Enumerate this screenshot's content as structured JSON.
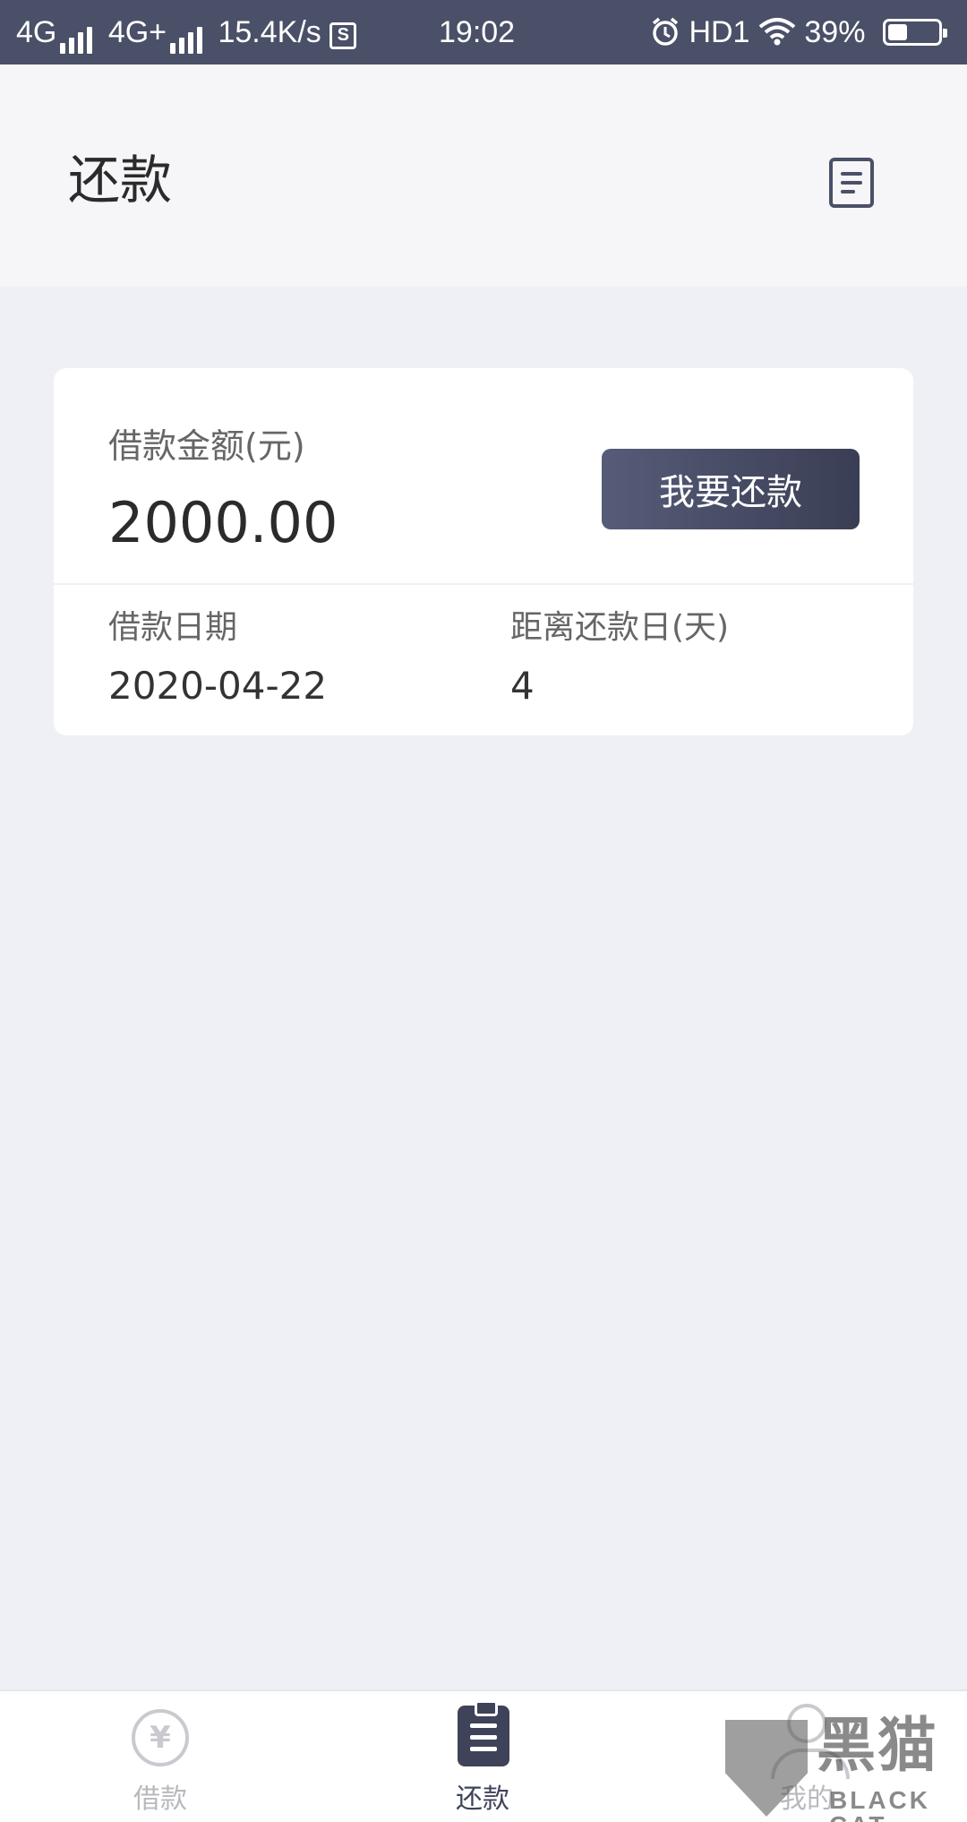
{
  "status_bar": {
    "network1": "4G",
    "network2": "4G+",
    "speed": "15.4K/s",
    "s_icon_text": "S",
    "time": "19:02",
    "hd": "HD1",
    "battery_percent": "39%",
    "battery_level": 0.39
  },
  "header": {
    "title": "还款",
    "bill_icon": "document-list-icon"
  },
  "loan_card": {
    "amount_label": "借款金额(元)",
    "amount_value": "2000.00",
    "repay_button": "我要还款",
    "date_label": "借款日期",
    "date_value": "2020-04-22",
    "days_label": "距离还款日(天)",
    "days_value": "4"
  },
  "tabbar": {
    "tabs": [
      {
        "label": "借款",
        "icon": "yen-circle-icon",
        "active": false
      },
      {
        "label": "还款",
        "icon": "clipboard-icon",
        "active": true
      },
      {
        "label": "我的",
        "icon": "user-icon",
        "active": false
      }
    ],
    "active_color": "#3f4359",
    "inactive_color": "#b8b8be"
  },
  "watermark": {
    "cn": "黑猫",
    "en": "BLACK CAT"
  },
  "colors": {
    "status_bar_bg": "#4a5067",
    "header_bg": "#f6f5f7",
    "page_bg": "#eef0f5",
    "button_bg": "#4a4f68"
  }
}
